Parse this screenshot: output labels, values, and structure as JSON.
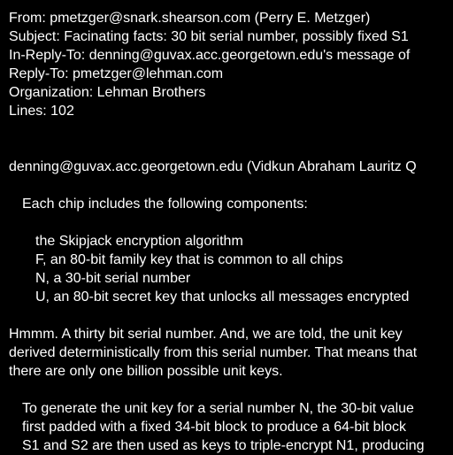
{
  "colors": {
    "background": "#000000",
    "text": "#ffffff"
  },
  "header": {
    "from": "From: pmetzger@snark.shearson.com (Perry E. Metzger)",
    "subject": "Subject: Facinating facts: 30 bit serial number, possibly fixed S1",
    "in_reply_to": "In-Reply-To: denning@guvax.acc.georgetown.edu's message of",
    "reply_to": "Reply-To: pmetzger@lehman.com",
    "organization": "Organization: Lehman Brothers",
    "lines": "Lines: 102"
  },
  "body": {
    "attribution": "denning@guvax.acc.georgetown.edu (Vidkun Abraham Lauritz Q",
    "quote_intro": "Each chip includes the following components:",
    "components": [
      "the Skipjack encryption algorithm",
      "F, an 80-bit family key that is common to all chips",
      "N, a 30-bit serial number",
      "U, an 80-bit secret key that unlocks all messages encrypted"
    ],
    "comment": [
      "Hmmm. A thirty bit serial number. And, we are told, the unit key",
      "derived deterministically from this serial number. That means that",
      "there are only one billion possible unit keys."
    ],
    "quote2": [
      "To generate the unit key for a serial number N, the 30-bit value",
      "first padded with a fixed 34-bit block to produce a 64-bit block",
      "S1 and S2 are then used as keys to triple-encrypt N1, producing"
    ]
  }
}
